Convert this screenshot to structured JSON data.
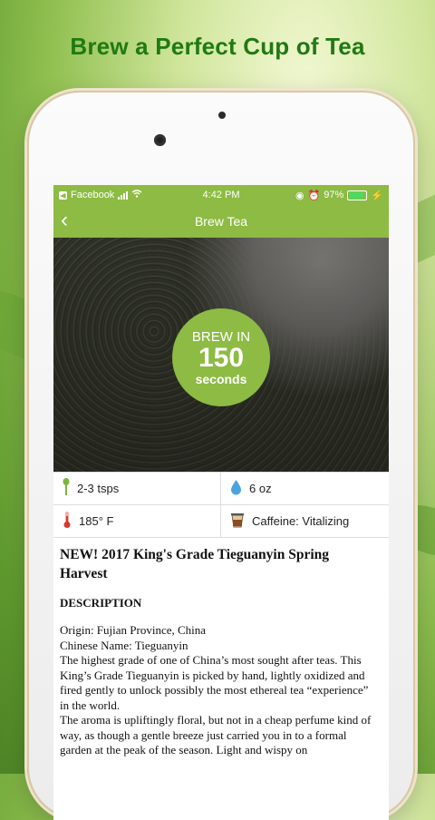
{
  "promo": {
    "headline": "Brew a Perfect Cup of Tea"
  },
  "status_bar": {
    "back_app": "Facebook",
    "time": "4:42 PM",
    "battery_percent": "97%",
    "battery_level": 0.97
  },
  "nav": {
    "back_glyph": "‹",
    "title": "Brew Tea"
  },
  "brew_timer": {
    "top": "BREW IN",
    "value": "150",
    "unit": "seconds"
  },
  "info": {
    "amount": {
      "icon": "spoon-icon",
      "text": "2-3 tsps"
    },
    "water": {
      "icon": "water-drop-icon",
      "text": "6 oz"
    },
    "temperature": {
      "icon": "thermometer-icon",
      "text": "185° F"
    },
    "caffeine": {
      "icon": "tea-cup-icon",
      "text": "Caffeine: Vitalizing"
    }
  },
  "tea": {
    "title": "NEW! 2017 King's Grade Tieguanyin Spring Harvest",
    "description_heading": "DESCRIPTION",
    "lines": [
      "Origin: Fujian Province, China",
      "Chinese Name: Tieguanyin",
      "The highest grade of one of China’s most sought after teas. This King’s Grade Tieguanyin is picked by hand, lightly oxidized and fired gently to unlock possibly the most ethereal tea “experience” in the world.",
      "The aroma is upliftingly floral, but not in a cheap perfume kind of way, as though a gentle breeze just carried you in to a formal garden at the peak of the season. Light and wispy on"
    ]
  },
  "colors": {
    "accent": "#8dbb43",
    "headline": "#1f7a12"
  }
}
